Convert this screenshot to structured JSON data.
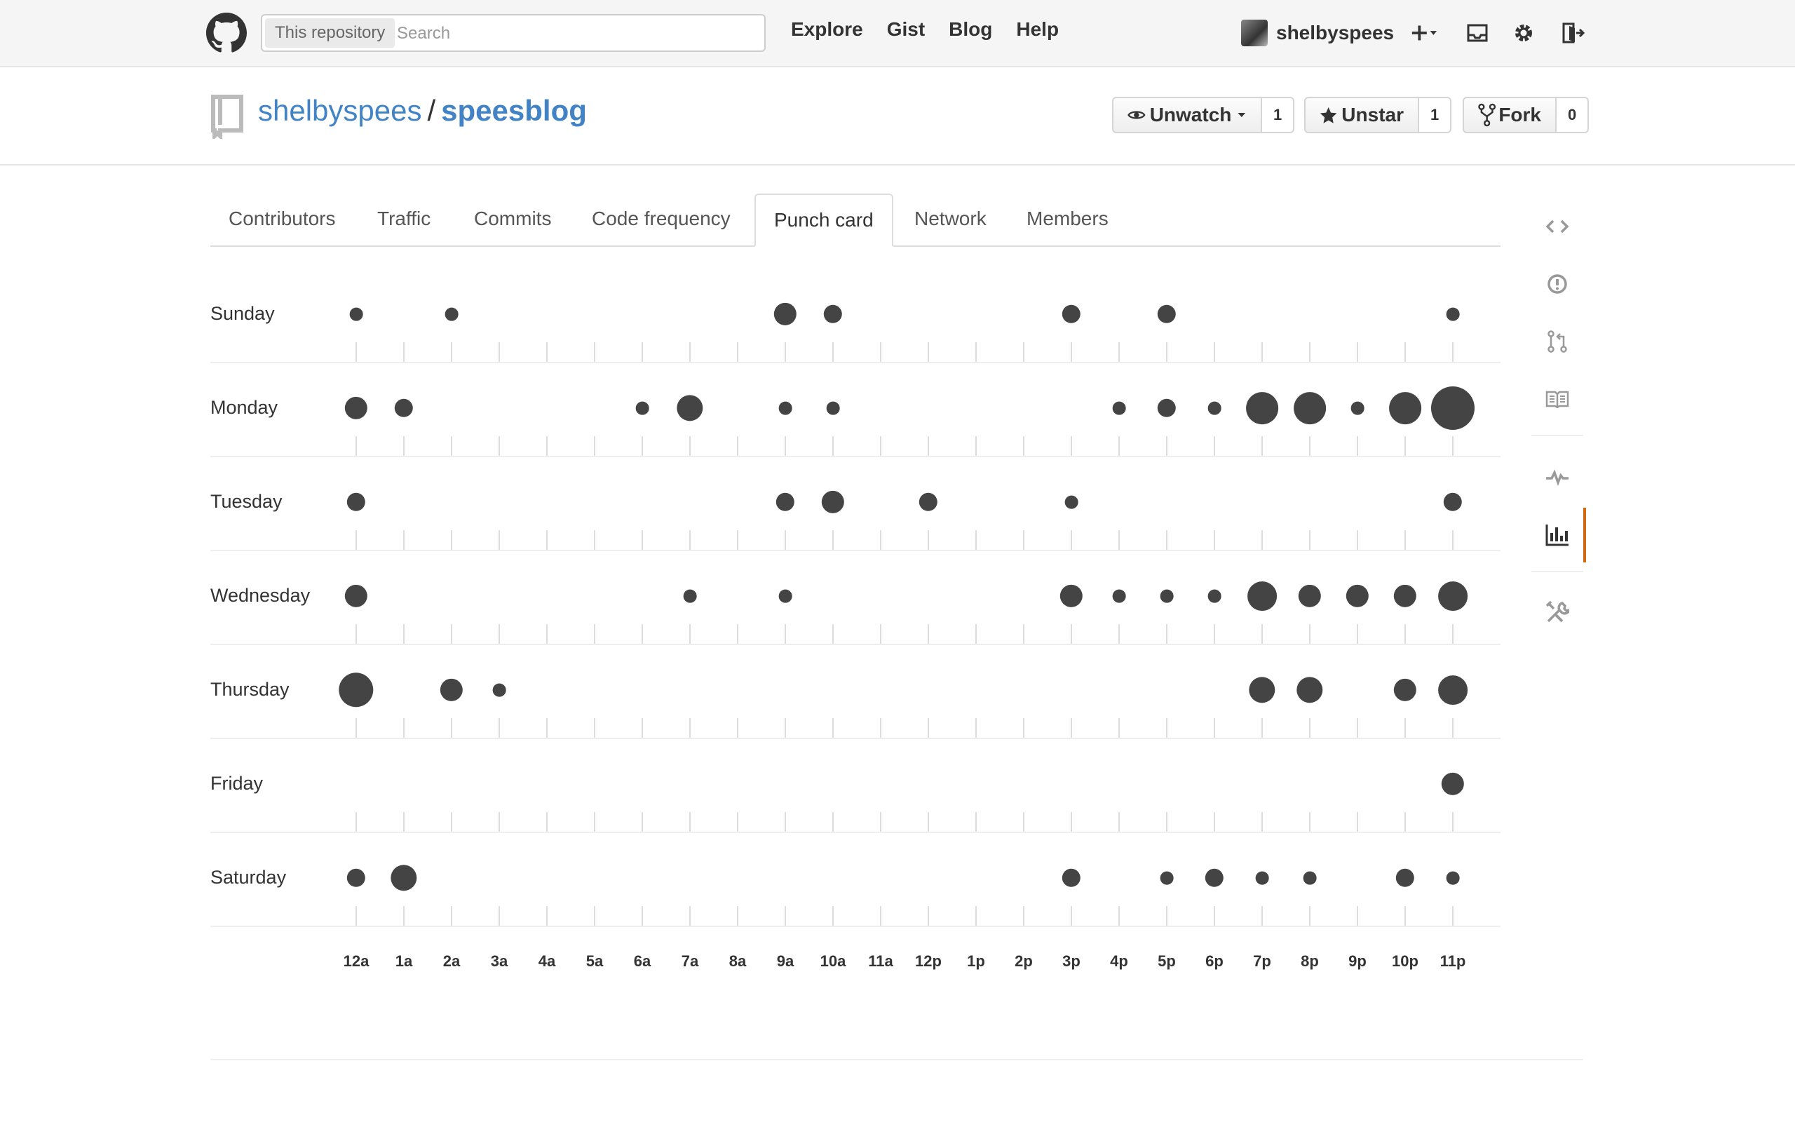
{
  "header": {
    "scope_label": "This repository",
    "search_placeholder": "Search",
    "nav": [
      "Explore",
      "Gist",
      "Blog",
      "Help"
    ],
    "username": "shelbyspees"
  },
  "repo": {
    "owner": "shelbyspees",
    "separator": "/",
    "name": "speesblog",
    "watch_label": "Unwatch",
    "watch_count": "1",
    "star_label": "Unstar",
    "star_count": "1",
    "fork_label": "Fork",
    "fork_count": "0"
  },
  "tabs": [
    "Contributors",
    "Traffic",
    "Commits",
    "Code frequency",
    "Punch card",
    "Network",
    "Members"
  ],
  "active_tab": "Punch card",
  "sidebar_icons": [
    "code-icon",
    "issues-icon",
    "pull-request-icon",
    "wiki-icon",
    "pulse-icon",
    "graphs-icon",
    "settings-icon"
  ],
  "chart_data": {
    "type": "punchcard",
    "days": [
      "Sunday",
      "Monday",
      "Tuesday",
      "Wednesday",
      "Thursday",
      "Friday",
      "Saturday"
    ],
    "hours": [
      "12a",
      "1a",
      "2a",
      "3a",
      "4a",
      "5a",
      "6a",
      "7a",
      "8a",
      "9a",
      "10a",
      "11a",
      "12p",
      "1p",
      "2p",
      "3p",
      "4p",
      "5p",
      "6p",
      "7p",
      "8p",
      "9p",
      "10p",
      "11p"
    ],
    "values": [
      [
        1,
        0,
        1,
        0,
        0,
        0,
        0,
        0,
        0,
        3,
        2,
        0,
        0,
        0,
        0,
        2,
        0,
        2,
        0,
        0,
        0,
        0,
        0,
        1
      ],
      [
        3,
        2,
        0,
        0,
        0,
        0,
        1,
        4,
        0,
        1,
        1,
        0,
        0,
        0,
        0,
        0,
        1,
        2,
        1,
        6,
        6,
        1,
        6,
        11
      ],
      [
        2,
        0,
        0,
        0,
        0,
        0,
        0,
        0,
        0,
        2,
        3,
        0,
        2,
        0,
        0,
        1,
        0,
        0,
        0,
        0,
        0,
        0,
        0,
        2
      ],
      [
        3,
        0,
        0,
        0,
        0,
        0,
        0,
        1,
        0,
        1,
        0,
        0,
        0,
        0,
        0,
        3,
        1,
        1,
        1,
        5,
        3,
        3,
        3,
        5
      ],
      [
        7,
        0,
        3,
        1,
        0,
        0,
        0,
        0,
        0,
        0,
        0,
        0,
        0,
        0,
        0,
        0,
        0,
        0,
        0,
        4,
        4,
        0,
        3,
        5
      ],
      [
        0,
        0,
        0,
        0,
        0,
        0,
        0,
        0,
        0,
        0,
        0,
        0,
        0,
        0,
        0,
        0,
        0,
        0,
        0,
        0,
        0,
        0,
        0,
        3
      ],
      [
        2,
        4,
        0,
        0,
        0,
        0,
        0,
        0,
        0,
        0,
        0,
        0,
        0,
        0,
        0,
        2,
        0,
        1,
        2,
        1,
        1,
        0,
        2,
        1
      ]
    ]
  }
}
